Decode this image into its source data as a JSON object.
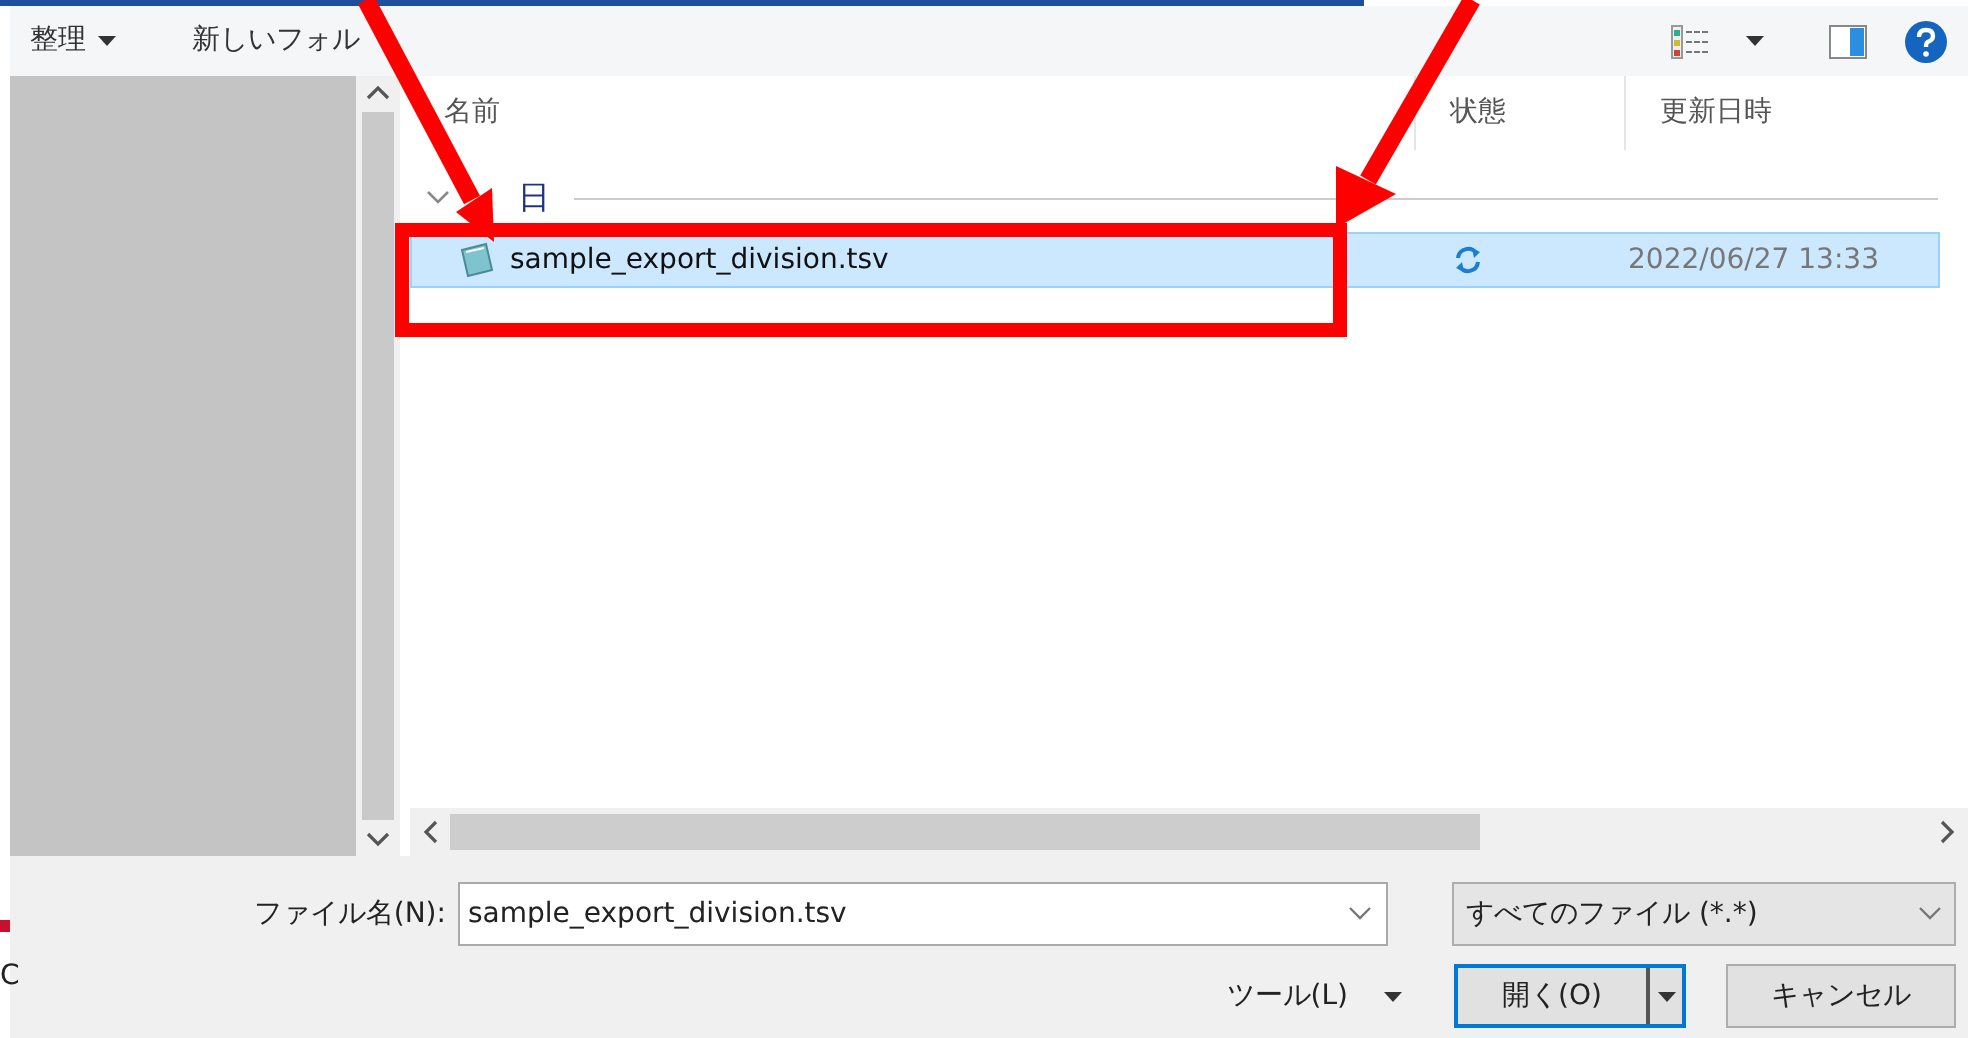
{
  "toolbar": {
    "buttons": [
      {
        "label": "整理",
        "dropdown": true
      },
      {
        "label": "新しいフォル",
        "dropdown": false
      }
    ]
  },
  "columns": [
    {
      "label": "名前"
    },
    {
      "label": "状態"
    },
    {
      "label": "更新日時"
    }
  ],
  "groups": [
    {
      "label": "日",
      "expanded": true,
      "files": [
        {
          "name": "sample_export_division.tsv",
          "syncing": true,
          "modified": "2022/06/27 13:33",
          "selected": true
        }
      ]
    }
  ],
  "filename": {
    "label": "ファイル名(N):",
    "value": "sample_export_division.tsv"
  },
  "filetype": {
    "value": "すべてのファイル (*.*)"
  },
  "buttons": [
    {
      "label": "ツール(L)",
      "kind": "menu"
    },
    {
      "label": "開く(O)",
      "kind": "split"
    },
    {
      "label": "キャンセル",
      "kind": "plain"
    }
  ],
  "background_text": "C"
}
